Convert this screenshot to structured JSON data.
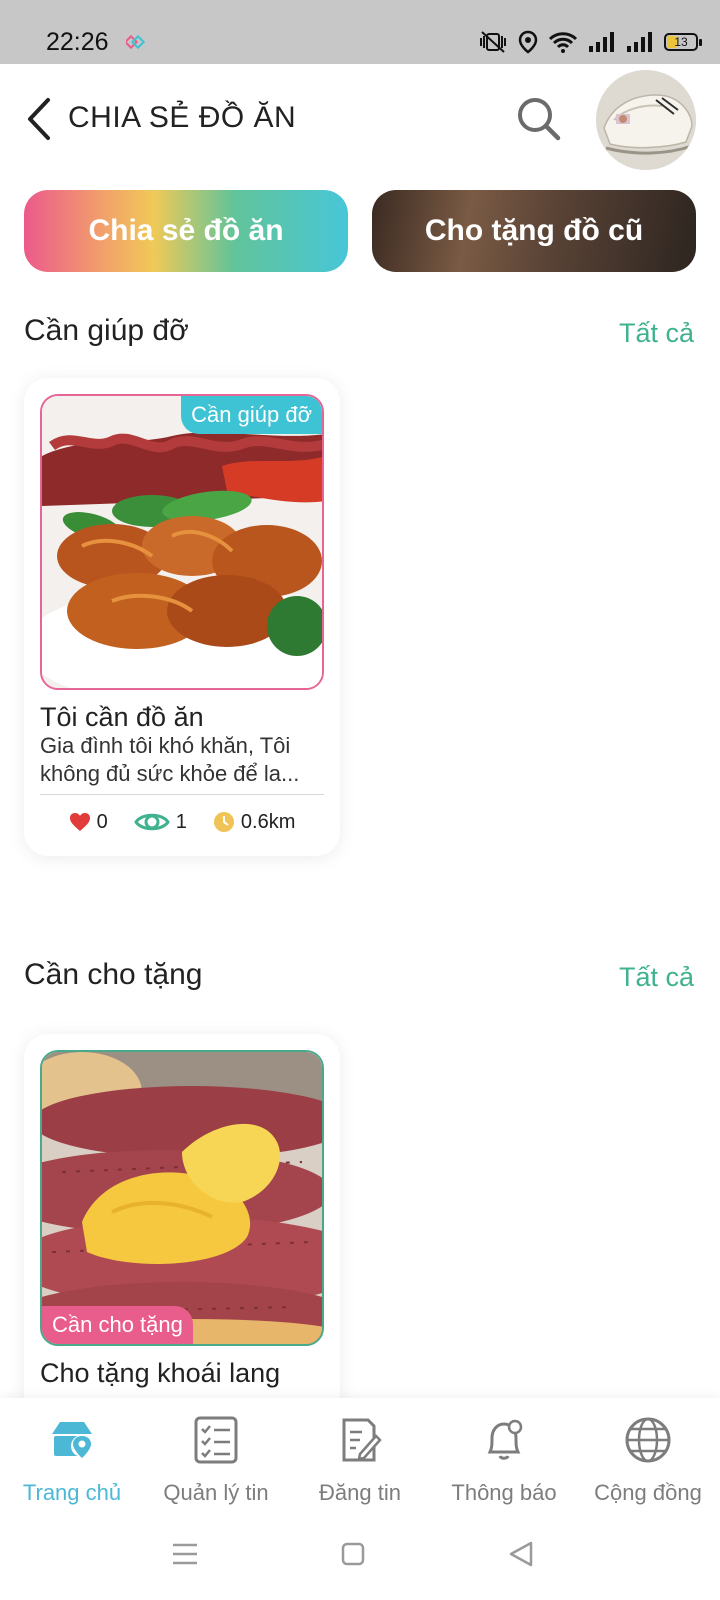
{
  "status_bar": {
    "time": "22:26",
    "battery": "13"
  },
  "header": {
    "title": "CHIA SẺ ĐỒ ĂN",
    "back_icon": "chevron-left-icon",
    "search_icon": "search-icon"
  },
  "tabs": [
    {
      "label": "Chia sẻ đồ ăn",
      "active": true
    },
    {
      "label": "Cho tặng đồ cũ",
      "active": false
    }
  ],
  "sections": [
    {
      "title": "Cần giúp đỡ",
      "see_all": "Tất cả",
      "card": {
        "badge": "Cần giúp đỡ",
        "title": "Tôi cần đồ ăn",
        "description": "Gia đình tôi khó khăn, Tôi không đủ sức khỏe để la...",
        "likes": "0",
        "views": "1",
        "distance": "0.6km"
      }
    },
    {
      "title": "Cần cho tặng",
      "see_all": "Tất cả",
      "card": {
        "badge": "Cần cho tặng",
        "title": "Cho tặng khoái lang"
      }
    }
  ],
  "bottom_nav": [
    {
      "label": "Trang chủ",
      "icon": "home-icon",
      "active": true
    },
    {
      "label": "Quản lý tin",
      "icon": "checklist-icon",
      "active": false
    },
    {
      "label": "Đăng tin",
      "icon": "post-edit-icon",
      "active": false
    },
    {
      "label": "Thông báo",
      "icon": "bell-icon",
      "active": false
    },
    {
      "label": "Cộng đồng",
      "icon": "globe-icon",
      "active": false
    }
  ],
  "colors": {
    "accent": "#3fb28f",
    "nav_active": "#4cb8d6",
    "pink": "#e85d8b",
    "cyan": "#3ec3d4"
  }
}
